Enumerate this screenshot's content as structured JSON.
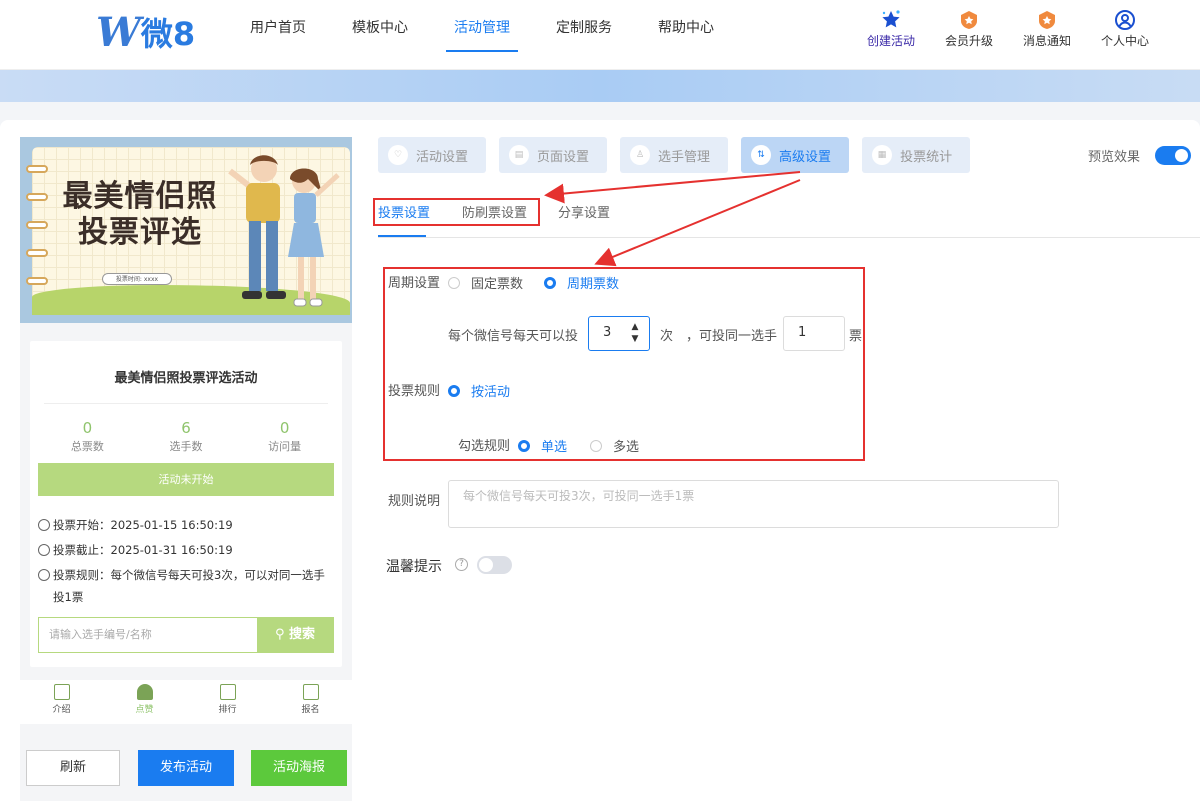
{
  "brand": {
    "logo_letter": "W",
    "logo_text": "微8"
  },
  "nav": {
    "items": [
      {
        "label": "用户首页"
      },
      {
        "label": "模板中心"
      },
      {
        "label": "活动管理"
      },
      {
        "label": "定制服务"
      },
      {
        "label": "帮助中心"
      }
    ]
  },
  "toolbar": {
    "create": "创建活动",
    "member": "会员升级",
    "message": "消息通知",
    "profile": "个人中心"
  },
  "preview_panel": {
    "poster_title_line1": "最美情侣照",
    "poster_title_line2": "投票评选",
    "poster_time": "投票时间: xxxx",
    "activity_name": "最美情侣照投票评选活动",
    "stats": [
      {
        "value": "0",
        "label": "总票数"
      },
      {
        "value": "6",
        "label": "选手数"
      },
      {
        "value": "0",
        "label": "访问量"
      }
    ],
    "status": "活动未开始",
    "vote_start": "投票开始：2025-01-15 16:50:19",
    "vote_end": "投票截止：2025-01-31 16:50:19",
    "vote_rule": "投票规则：每个微信号每天可投3次，可以对同一选手投1票",
    "search_placeholder": "请输入选手编号/名称",
    "search_button": "搜索",
    "tabs": [
      {
        "label": "介绍"
      },
      {
        "label": "点赞"
      },
      {
        "label": "排行"
      },
      {
        "label": "报名"
      }
    ]
  },
  "actions": {
    "refresh": "刷新",
    "publish": "发布活动",
    "poster": "活动海报"
  },
  "steps": [
    {
      "label": "活动设置"
    },
    {
      "label": "页面设置"
    },
    {
      "label": "选手管理"
    },
    {
      "label": "高级设置"
    },
    {
      "label": "投票统计"
    }
  ],
  "preview_toggle": {
    "label": "预览效果",
    "on": true
  },
  "subtabs": [
    {
      "label": "投票设置"
    },
    {
      "label": "防刷票设置"
    },
    {
      "label": "分享设置"
    }
  ],
  "form": {
    "period_label": "周期设置",
    "period_fixed": "固定票数",
    "period_cycle": "周期票数",
    "per_day_text": "每个微信号每天可以投",
    "per_day_value": "3",
    "times_unit": "次",
    "same_player_text": "，可投同一选手",
    "same_player_value": "1",
    "votes_unit": "票",
    "rule_label": "投票规则",
    "rule_by_activity": "按活动",
    "check_rule_label": "勾选规则",
    "single": "单选",
    "multi": "多选",
    "desc_label": "规则说明",
    "desc_placeholder": "每个微信号每天可投3次，可投同一选手1票",
    "tip_label": "温馨提示",
    "tip_on": false
  },
  "colors": {
    "primary": "#1a7cf0",
    "green": "#b6d97f",
    "annotation": "#e5312f"
  }
}
